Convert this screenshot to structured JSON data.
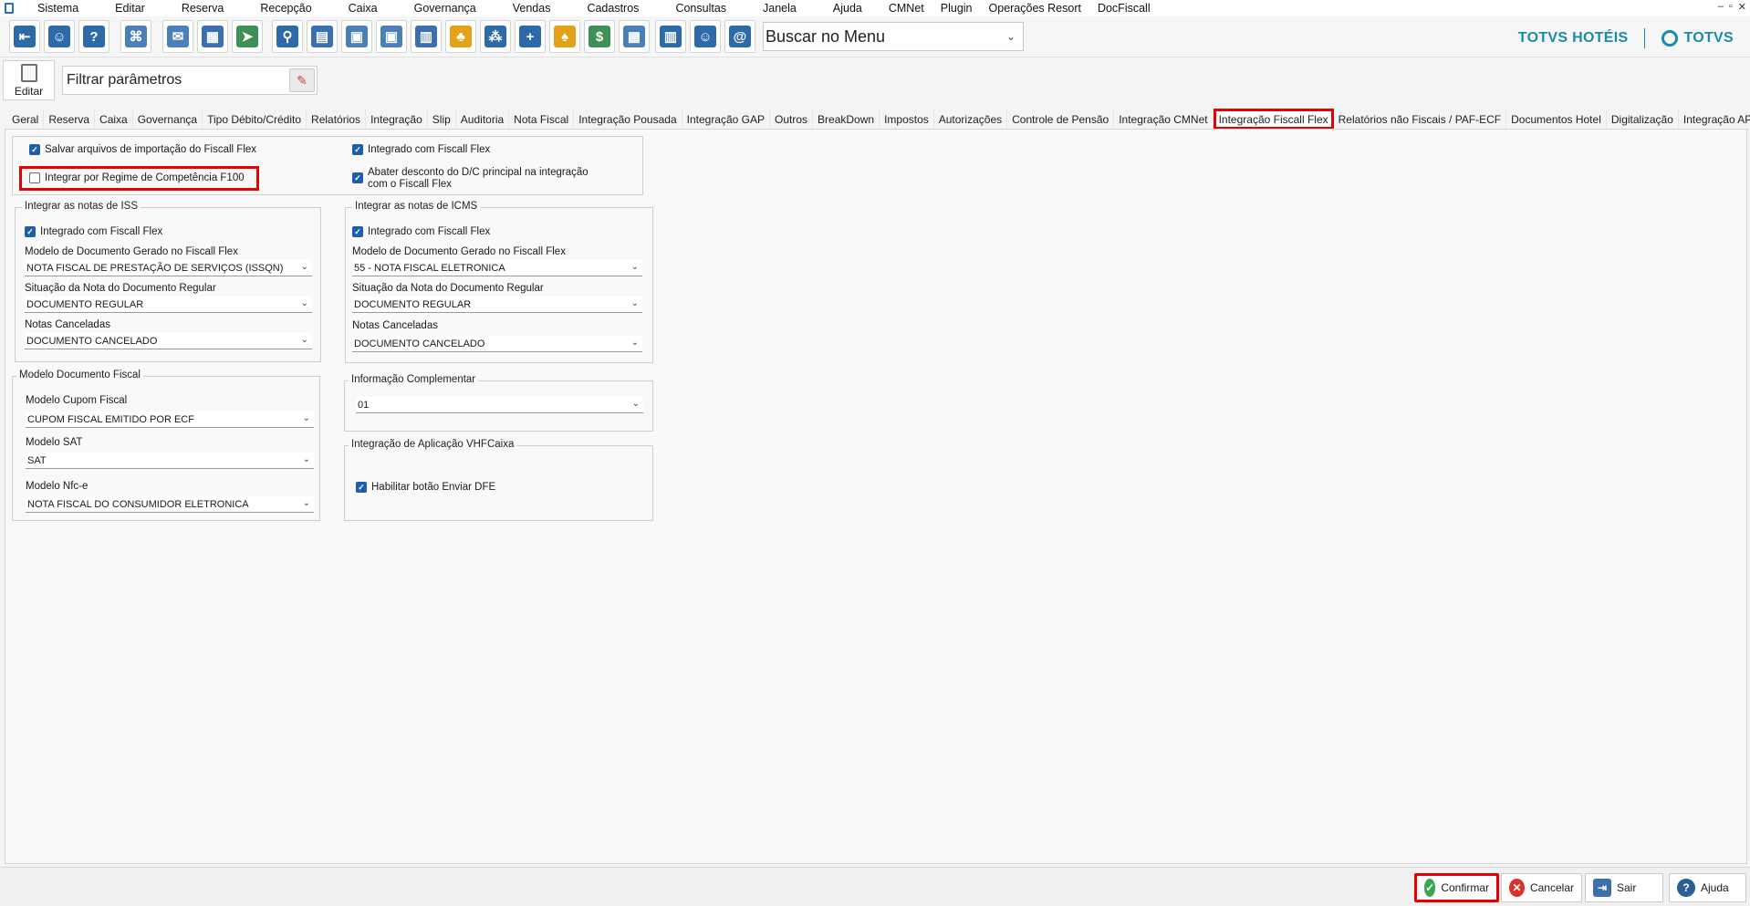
{
  "menu": [
    "Sistema",
    "Editar",
    "Reserva",
    "Recepção",
    "Caixa",
    "Governança",
    "Vendas",
    "Cadastros",
    "Consultas",
    "Janela",
    "Ajuda",
    "CMNet",
    "Plugin",
    "Operações Resort",
    "DocFiscall"
  ],
  "window_controls": [
    "–",
    "▫",
    "✕"
  ],
  "toolbar": {
    "search_menu": "Buscar no Menu",
    "icons": [
      "exit-icon",
      "user-key-icon",
      "help-icon",
      "org-chart-icon",
      "mail-icon",
      "grid-edit-icon",
      "mail-send-icon",
      "search-icon",
      "calendar-icon",
      "guest-card-icon",
      "room-card-icon",
      "guest-list-icon",
      "bell-icon",
      "footsteps-icon",
      "add-user-icon",
      "bell-service-icon",
      "calendar-money-icon",
      "table-icon",
      "cashier-icon",
      "receptionist-icon",
      "email-book-icon"
    ]
  },
  "brand": {
    "hotel": "TOTVS HOTÉIS",
    "company": "TOTVS"
  },
  "edit_label": "Editar",
  "filter_value": "Filtrar parâmetros",
  "tabs": [
    "Geral",
    "Reserva",
    "Caixa",
    "Governança",
    "Tipo Débito/Crédito",
    "Relatórios",
    "Integração",
    "Slip",
    "Auditoria",
    "Nota Fiscal",
    "Integração Pousada",
    "Integração GAP",
    "Outros",
    "BreakDown",
    "Impostos",
    "Autorizações",
    "Controle de Pensão",
    "Integração CMNet",
    "Integração Fiscall Flex",
    "Relatórios não Fiscais / PAF-ECF",
    "Documentos Hotel",
    "Digitalização",
    "Integração API"
  ],
  "active_tab": "Integração Fiscall Flex",
  "top_section": {
    "salvar_arquivos": "Salvar arquivos de importação do Fiscall Flex",
    "integrar_regime": "Integrar por Regime de Competência F100",
    "integrado": "Integrado com Fiscall Flex",
    "abater_line1": "Abater desconto do D/C principal na integração",
    "abater_line2": "com o Fiscall Flex"
  },
  "iss": {
    "title": "Integrar as notas de ISS",
    "integrado": "Integrado com Fiscall Flex",
    "modelo_label": "Modelo de Documento Gerado no Fiscall Flex",
    "modelo_value": "NOTA FISCAL DE PRESTAÇÃO DE SERVIÇOS (ISSQN)",
    "situacao_label": "Situação da Nota do Documento Regular",
    "situacao_value": "DOCUMENTO REGULAR",
    "canceladas_label": "Notas Canceladas",
    "canceladas_value": "DOCUMENTO CANCELADO"
  },
  "icms": {
    "title": "Integrar as notas de ICMS",
    "integrado": "Integrado com Fiscall Flex",
    "modelo_label": "Modelo de Documento Gerado no Fiscall Flex",
    "modelo_value": "55 - NOTA FISCAL ELETRONICA",
    "situacao_label": "Situação da Nota do Documento Regular",
    "situacao_value": "DOCUMENTO REGULAR",
    "canceladas_label": "Notas Canceladas",
    "canceladas_value": "DOCUMENTO CANCELADO"
  },
  "modelo_doc": {
    "title": "Modelo Documento Fiscal",
    "cupom_label": "Modelo Cupom Fiscal",
    "cupom_value": "CUPOM FISCAL EMITIDO POR ECF",
    "sat_label": "Modelo SAT",
    "sat_value": "SAT",
    "nfce_label": "Modelo Nfc-e",
    "nfce_value": "NOTA FISCAL DO CONSUMIDOR ELETRONICA"
  },
  "info_comp": {
    "title": "Informação Complementar",
    "value": "01"
  },
  "vhf": {
    "title": "Integração de Aplicação VHFCaixa",
    "habilitar": "Habilitar botão Enviar DFE"
  },
  "buttons": {
    "confirm": "Confirmar",
    "cancel": "Cancelar",
    "exit": "Sair",
    "help": "Ajuda"
  },
  "colors": {
    "accent": "#1f5fa8",
    "highlight": "#e60000",
    "brand": "#1b8aaa"
  }
}
